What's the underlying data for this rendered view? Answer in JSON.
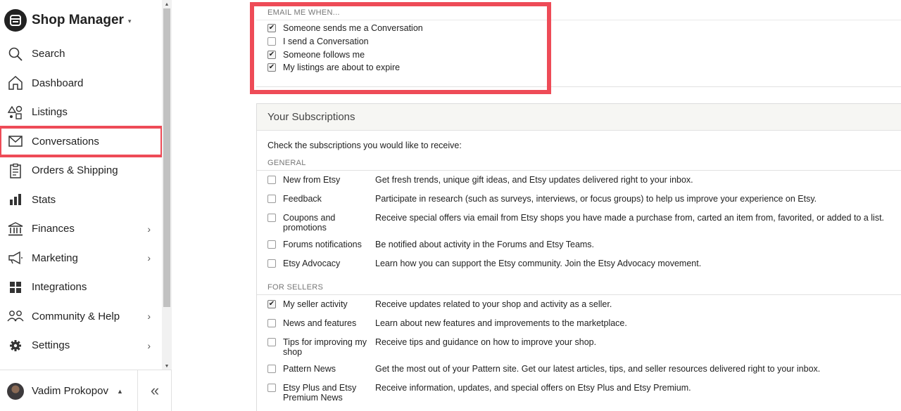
{
  "app": {
    "title": "Shop Manager",
    "caret": "▾"
  },
  "sidebar": {
    "items": [
      {
        "label": "Search",
        "icon": "search-icon",
        "chevron": false
      },
      {
        "label": "Dashboard",
        "icon": "home-icon",
        "chevron": false
      },
      {
        "label": "Listings",
        "icon": "shapes-icon",
        "chevron": false
      },
      {
        "label": "Conversations",
        "icon": "envelope-icon",
        "chevron": false,
        "active": true
      },
      {
        "label": "Orders & Shipping",
        "icon": "clipboard-icon",
        "chevron": false
      },
      {
        "label": "Stats",
        "icon": "bar-chart-icon",
        "chevron": false
      },
      {
        "label": "Finances",
        "icon": "bank-icon",
        "chevron": true
      },
      {
        "label": "Marketing",
        "icon": "megaphone-icon",
        "chevron": true
      },
      {
        "label": "Integrations",
        "icon": "grid-icon",
        "chevron": false
      },
      {
        "label": "Community & Help",
        "icon": "people-icon",
        "chevron": true
      },
      {
        "label": "Settings",
        "icon": "gear-icon",
        "chevron": true
      }
    ],
    "chevron_glyph": "›",
    "user": {
      "name": "Vadim Prokopov",
      "caret": "▲"
    },
    "collapse_glyph": "«"
  },
  "email_settings": {
    "section_label": "EMAIL ME WHEN...",
    "options": [
      {
        "label": "Someone sends me a Conversation",
        "checked": true
      },
      {
        "label": "I send a Conversation",
        "checked": false
      },
      {
        "label": "Someone follows me",
        "checked": true
      },
      {
        "label": "My listings are about to expire",
        "checked": true
      }
    ]
  },
  "subscriptions": {
    "title": "Your Subscriptions",
    "intro": "Check the subscriptions you would like to receive:",
    "groups": [
      {
        "label": "GENERAL",
        "items": [
          {
            "name": "New from Etsy",
            "desc": "Get fresh trends, unique gift ideas, and Etsy updates delivered right to your inbox.",
            "checked": false
          },
          {
            "name": "Feedback",
            "desc": "Participate in research (such as surveys, interviews, or focus groups) to help us improve your experience on Etsy.",
            "checked": false
          },
          {
            "name": "Coupons and promotions",
            "desc": "Receive special offers via email from Etsy shops you have made a purchase from, carted an item from, favorited, or added to a list.",
            "checked": false
          },
          {
            "name": "Forums notifications",
            "desc": "Be notified about activity in the Forums and Etsy Teams.",
            "checked": false
          },
          {
            "name": "Etsy Advocacy",
            "desc": "Learn how you can support the Etsy community. Join the Etsy Advocacy movement.",
            "checked": false
          }
        ]
      },
      {
        "label": "FOR SELLERS",
        "items": [
          {
            "name": "My seller activity",
            "desc": "Receive updates related to your shop and activity as a seller.",
            "checked": true
          },
          {
            "name": "News and features",
            "desc": "Learn about new features and improvements to the marketplace.",
            "checked": false
          },
          {
            "name": "Tips for improving my shop",
            "desc": "Receive tips and guidance on how to improve your shop.",
            "checked": false
          },
          {
            "name": "Pattern News",
            "desc": "Get the most out of your Pattern site. Get our latest articles, tips, and seller resources delivered right to your inbox.",
            "checked": false
          },
          {
            "name": "Etsy Plus and Etsy Premium News",
            "desc": "Receive information, updates, and special offers on Etsy Plus and Etsy Premium.",
            "checked": false
          }
        ]
      }
    ]
  },
  "colors": {
    "highlight": "#ee4b57",
    "text": "#222222",
    "muted": "#777777"
  }
}
